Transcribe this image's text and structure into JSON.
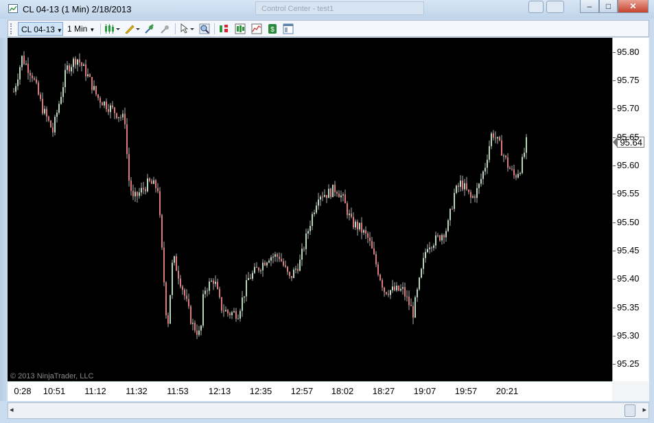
{
  "window": {
    "title": "CL 04-13 (1 Min)  2/18/2013",
    "background_tab": "Control Center - test1",
    "caption_buttons": {
      "minimize": "–",
      "maximize": "□",
      "close": "✕"
    }
  },
  "toolbar": {
    "instrument": "CL 04-13",
    "interval": "1 Min",
    "icons": [
      "chart-style-icon",
      "drawing-tool-icon",
      "pin-icon",
      "pin-gray-icon",
      "pointer-icon",
      "zoom-icon",
      "data-box-icon",
      "bars-icon",
      "indicators-icon",
      "strategies-icon",
      "properties-icon"
    ]
  },
  "chart": {
    "copyright": "© 2013 NinjaTrader, LLC",
    "current_price": "95.64",
    "scroll": {
      "left": "◂",
      "right": "▸"
    }
  },
  "chart_data": {
    "type": "candlestick",
    "price_axis": {
      "labels": [
        "95.80",
        "95.75",
        "95.70",
        "95.65",
        "95.60",
        "95.55",
        "95.50",
        "95.45",
        "95.40",
        "95.35",
        "95.30",
        "95.25"
      ],
      "range": [
        95.22,
        95.825
      ]
    },
    "time_axis": {
      "labels": [
        "0:28",
        "10:51",
        "11:12",
        "11:32",
        "11:53",
        "12:13",
        "12:35",
        "12:57",
        "18:02",
        "18:27",
        "19:07",
        "19:57",
        "20:21"
      ]
    },
    "up_color": "#b8d8c0",
    "down_color": "#e07a7a",
    "background": "#000000",
    "anchors": [
      [
        0,
        95.66
      ],
      [
        8,
        95.73
      ],
      [
        20,
        95.79
      ],
      [
        35,
        95.76
      ],
      [
        50,
        95.7
      ],
      [
        65,
        95.66
      ],
      [
        85,
        95.77
      ],
      [
        100,
        95.79
      ],
      [
        115,
        95.76
      ],
      [
        130,
        95.72
      ],
      [
        150,
        95.7
      ],
      [
        170,
        95.68
      ],
      [
        175,
        95.58
      ],
      [
        182,
        95.54
      ],
      [
        190,
        95.55
      ],
      [
        205,
        95.57
      ],
      [
        218,
        95.56
      ],
      [
        225,
        95.43
      ],
      [
        232,
        95.31
      ],
      [
        240,
        95.44
      ],
      [
        255,
        95.38
      ],
      [
        268,
        95.32
      ],
      [
        280,
        95.3
      ],
      [
        285,
        95.38
      ],
      [
        300,
        95.4
      ],
      [
        310,
        95.35
      ],
      [
        320,
        95.34
      ],
      [
        335,
        95.34
      ],
      [
        350,
        95.4
      ],
      [
        365,
        95.42
      ],
      [
        380,
        95.44
      ],
      [
        395,
        95.44
      ],
      [
        410,
        95.4
      ],
      [
        425,
        95.43
      ],
      [
        440,
        95.5
      ],
      [
        452,
        95.55
      ],
      [
        465,
        95.55
      ],
      [
        478,
        95.56
      ],
      [
        488,
        95.54
      ],
      [
        500,
        95.5
      ],
      [
        512,
        95.49
      ],
      [
        525,
        95.47
      ],
      [
        535,
        95.43
      ],
      [
        548,
        95.38
      ],
      [
        560,
        95.38
      ],
      [
        575,
        95.38
      ],
      [
        590,
        95.34
      ],
      [
        600,
        95.4
      ],
      [
        610,
        95.46
      ],
      [
        625,
        95.47
      ],
      [
        640,
        95.49
      ],
      [
        650,
        95.55
      ],
      [
        660,
        95.57
      ],
      [
        675,
        95.54
      ],
      [
        685,
        95.56
      ],
      [
        695,
        95.6
      ],
      [
        705,
        95.66
      ],
      [
        718,
        95.63
      ],
      [
        728,
        95.6
      ],
      [
        738,
        95.58
      ],
      [
        748,
        95.6
      ],
      [
        755,
        95.64
      ]
    ]
  }
}
